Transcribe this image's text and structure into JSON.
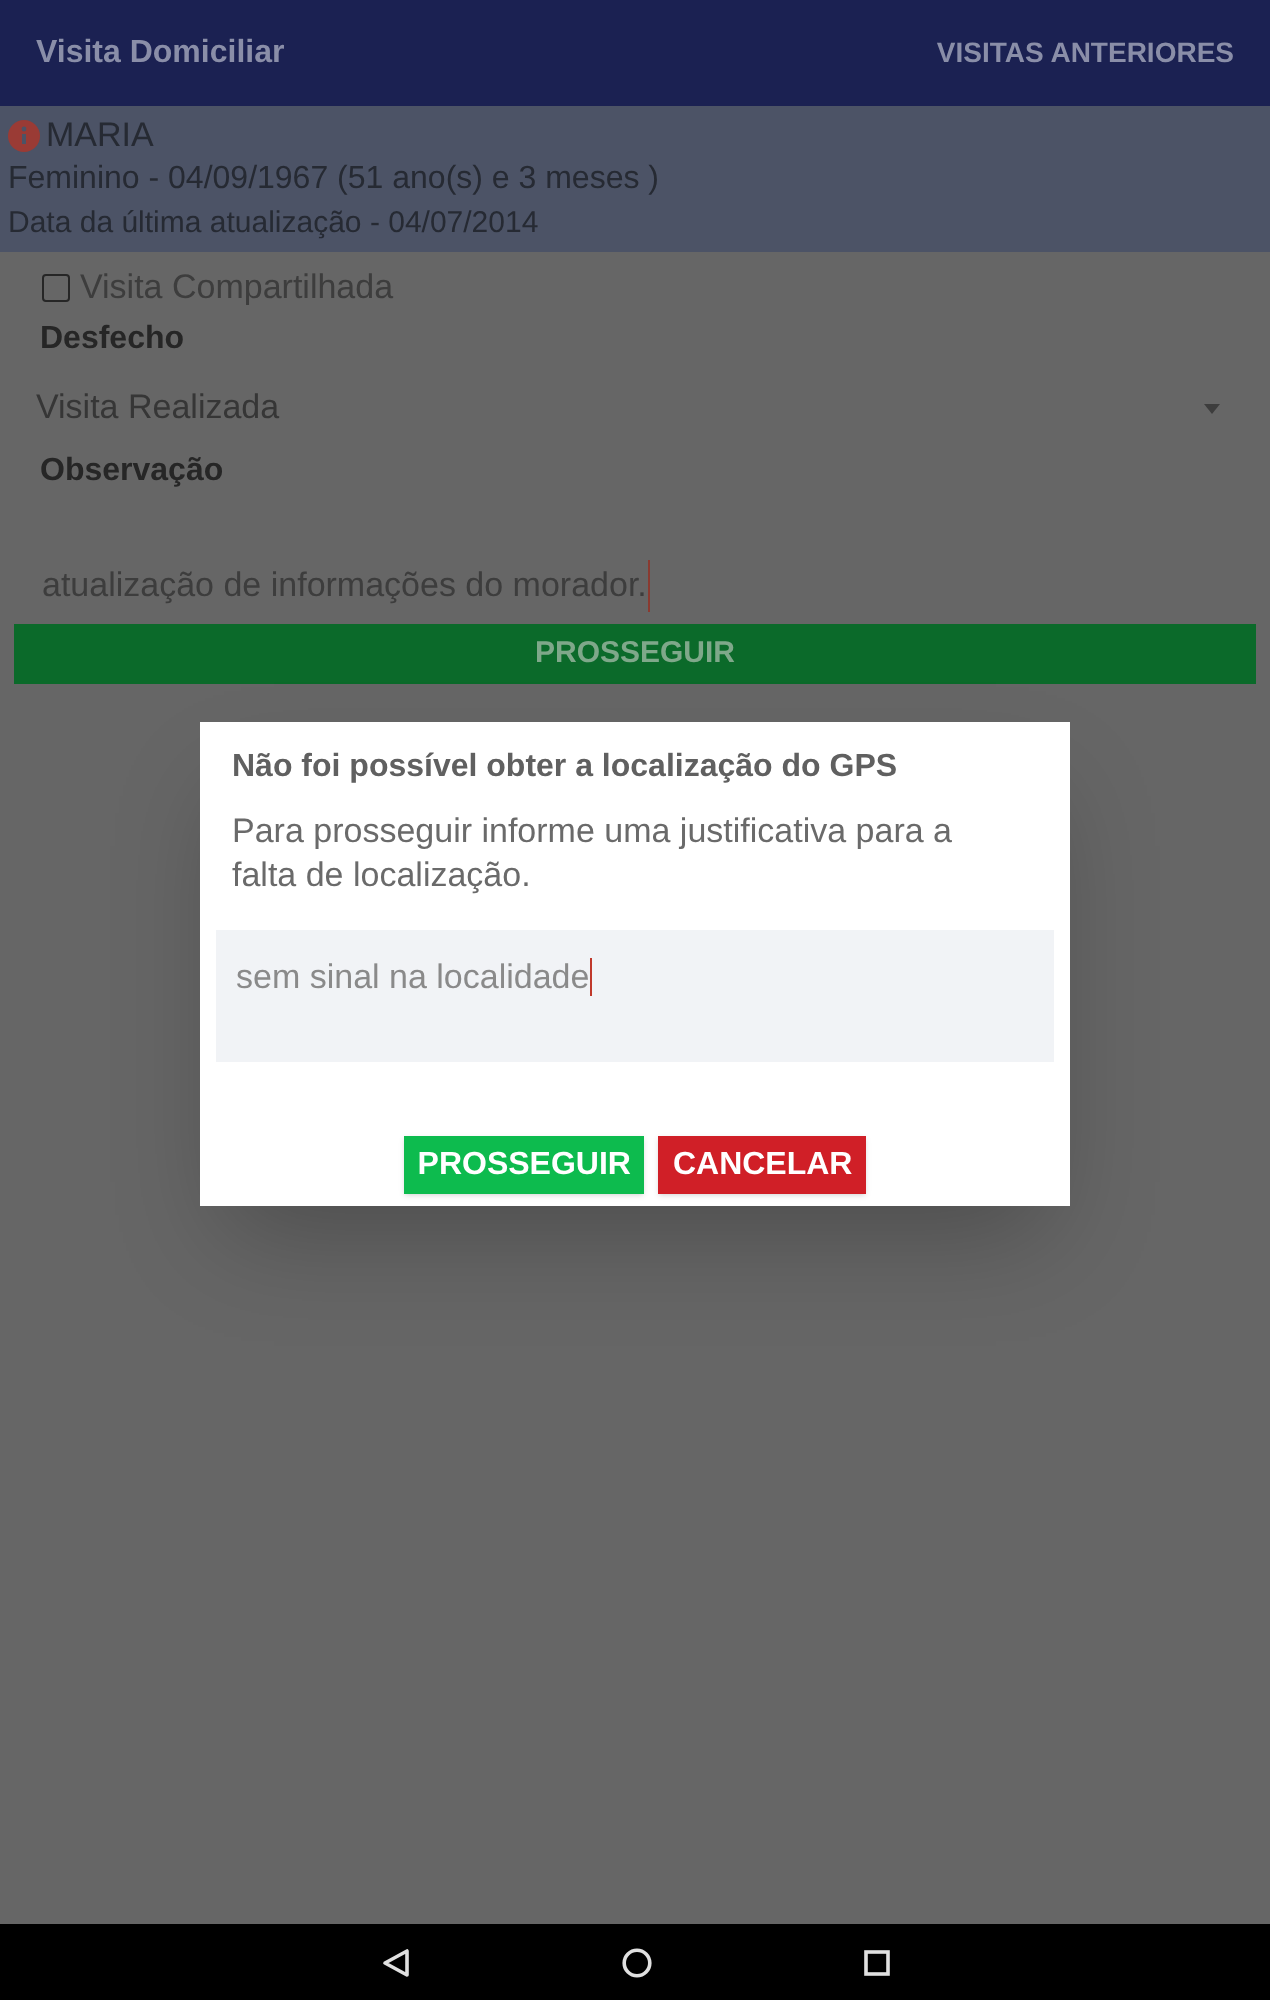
{
  "app_bar": {
    "title": "Visita Domiciliar",
    "action": "VISITAS ANTERIORES"
  },
  "patient": {
    "name": "MARIA",
    "details": "Feminino - 04/09/1967 (51 ano(s)  e 3 meses )",
    "updated": "Data da última atualização - 04/07/2014"
  },
  "form": {
    "shared_visit": {
      "label": "Visita Compartilhada",
      "checked": false
    },
    "outcome": {
      "label": "Desfecho",
      "value": "Visita Realizada"
    },
    "observation": {
      "label": "Observação",
      "value": "atualização de informações do morador."
    },
    "proceed_button": "PROSSEGUIR"
  },
  "dialog": {
    "title": "Não foi possível obter a localização do GPS",
    "message": "Para prosseguir informe uma justificativa para a falta de localização.",
    "justification": {
      "value": "sem sinal na localidade"
    },
    "buttons": [
      {
        "label": "PROSSEGUIR",
        "kind": "confirm"
      },
      {
        "label": "CANCELAR",
        "kind": "cancel"
      }
    ]
  }
}
